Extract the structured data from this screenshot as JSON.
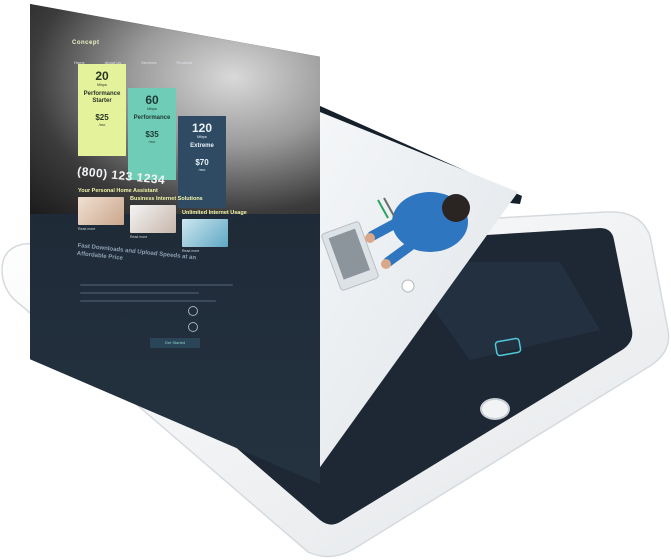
{
  "site": {
    "logo": "Concept",
    "nav": [
      "Home",
      "About Us",
      "Services",
      "Products"
    ],
    "plans": [
      {
        "num": "20",
        "unit": "Mbps",
        "name": "Performance Starter",
        "price": "$25",
        "per": "/mo"
      },
      {
        "num": "60",
        "unit": "Mbps",
        "name": "Performance",
        "price": "$35",
        "per": "/mo"
      },
      {
        "num": "120",
        "unit": "Mbps",
        "name": "Extreme",
        "price": "$70",
        "per": "/mo"
      }
    ],
    "phone": "(800) 123 1234",
    "tiles": [
      {
        "title": "Your Personal Home Assistant",
        "link": "Read more"
      },
      {
        "title": "Business Internet Solutions",
        "link": "Read more"
      },
      {
        "title": "Unlimited Internet Usage",
        "link": "Read more"
      }
    ],
    "slogan": "Fast Downloads and Upload Speeds at an Affordable Price",
    "cta": "Get Started"
  },
  "colors": {
    "plan_lime": "#e4f39b",
    "plan_teal": "#6fcdb7",
    "plan_navy": "#2e4b63",
    "page_dark": "#1f2a37",
    "tablet_white": "#f4f5f6"
  }
}
